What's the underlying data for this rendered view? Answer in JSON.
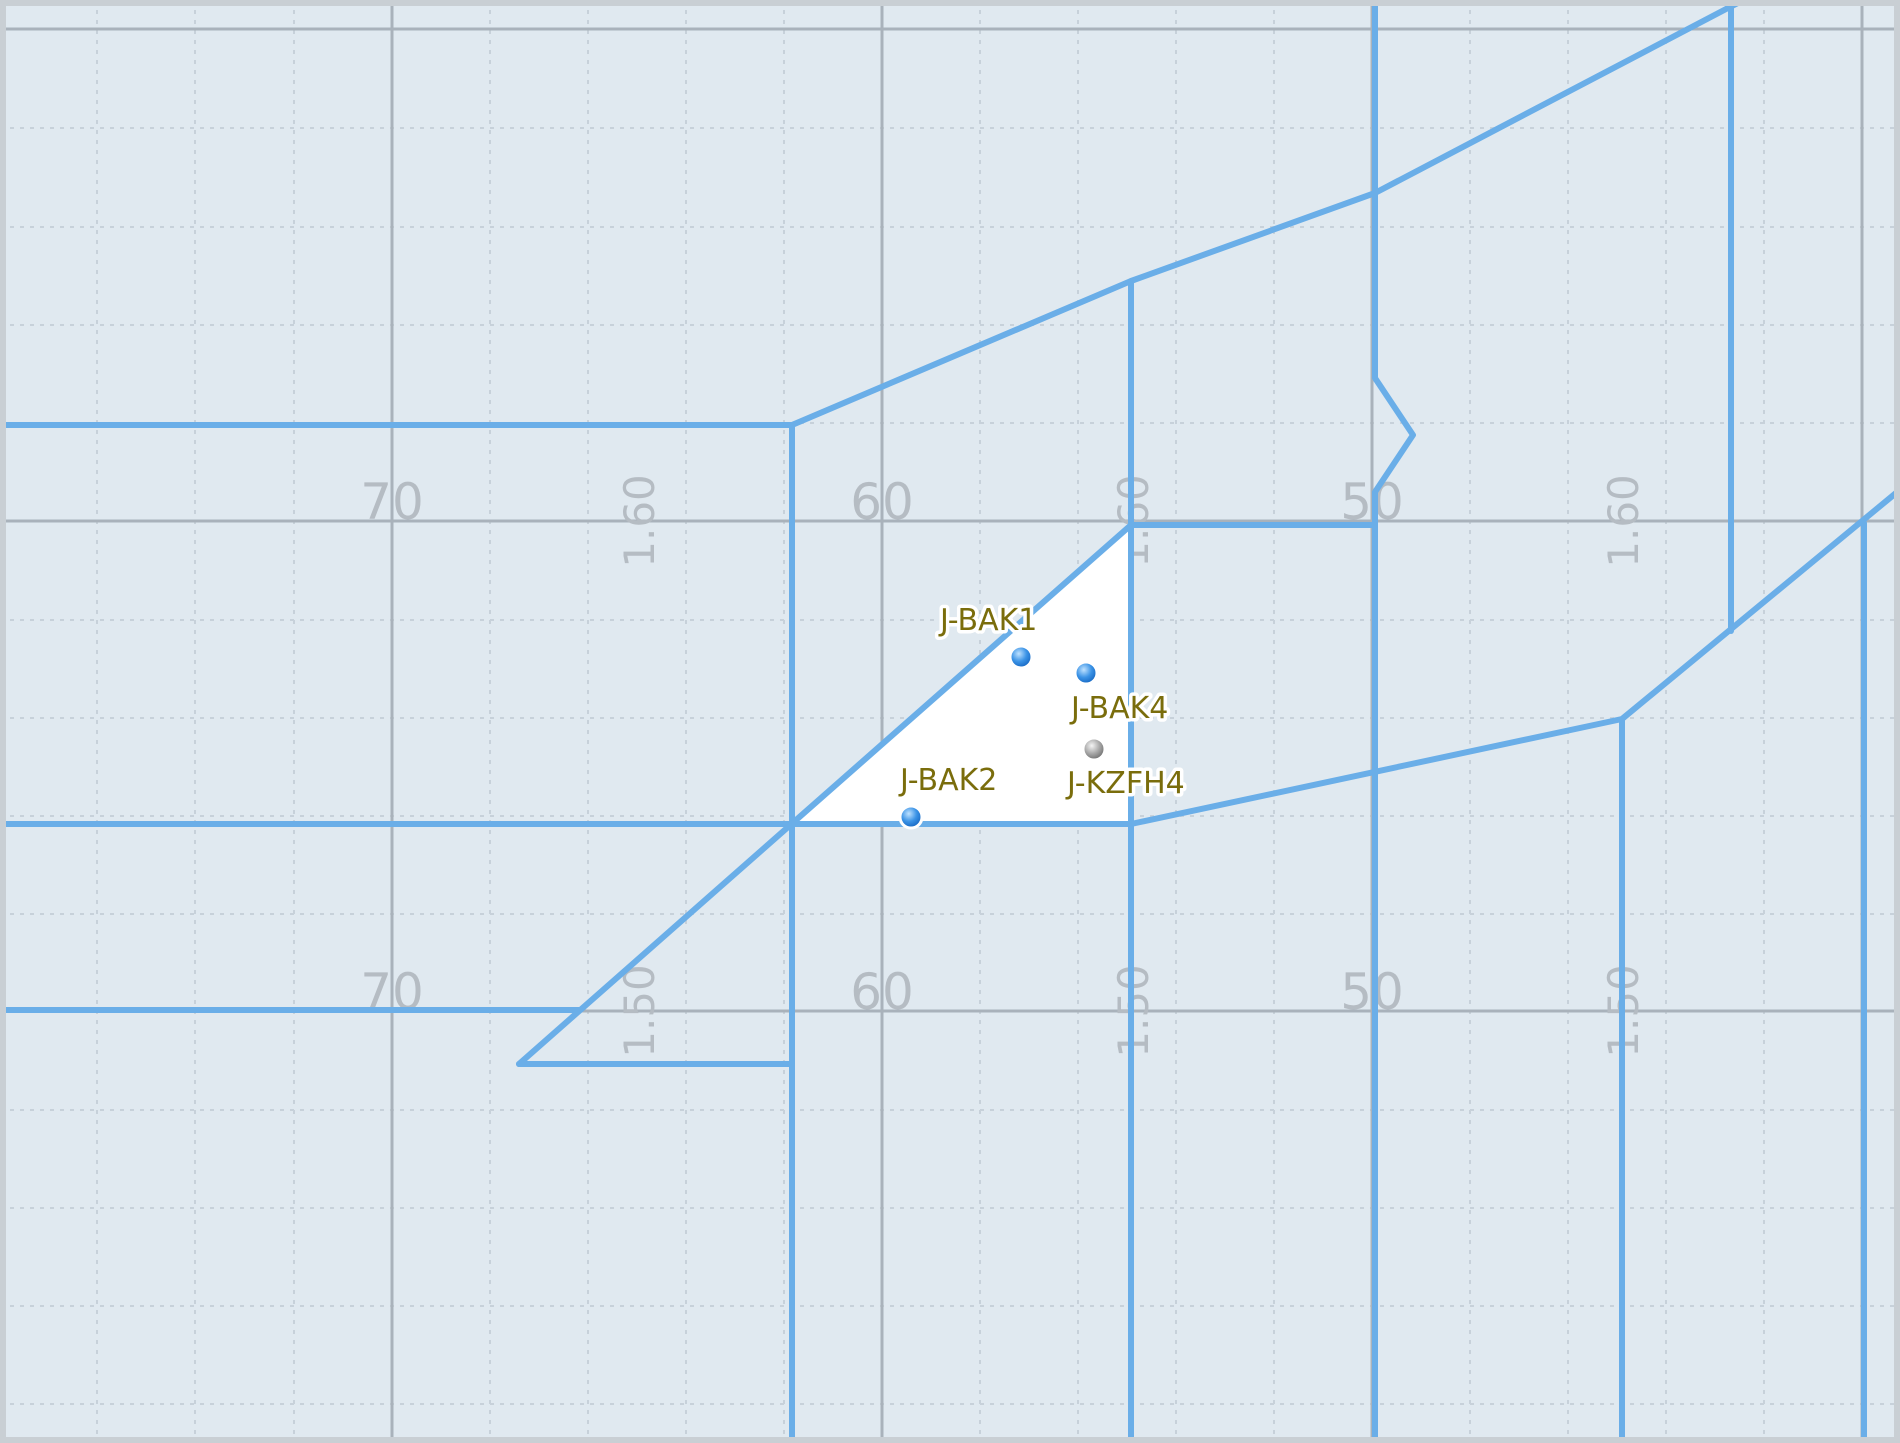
{
  "grid_labels": {
    "row1": {
      "a": "70",
      "b": "1.60",
      "c": "60",
      "d": "1.60",
      "e": "50",
      "f": "1.60"
    },
    "row2": {
      "a": "70",
      "b": "1.50",
      "c": "60",
      "d": "1.50",
      "e": "50",
      "f": "1.50"
    }
  },
  "wells": [
    {
      "label": "J-BAK1",
      "status": "active",
      "color": "#2f86e0"
    },
    {
      "label": "J-BAK4",
      "status": "active",
      "color": "#2f86e0"
    },
    {
      "label": "J-KZFH4",
      "status": "inactive",
      "color": "#9a9a9a"
    },
    {
      "label": "J-BAK2",
      "status": "active",
      "color": "#2f86e0"
    }
  ],
  "colors": {
    "background": "#e0e9f0",
    "boundary": "#6aaee8",
    "highlight": "#ffffff",
    "label_text": "#7a6d0c"
  }
}
